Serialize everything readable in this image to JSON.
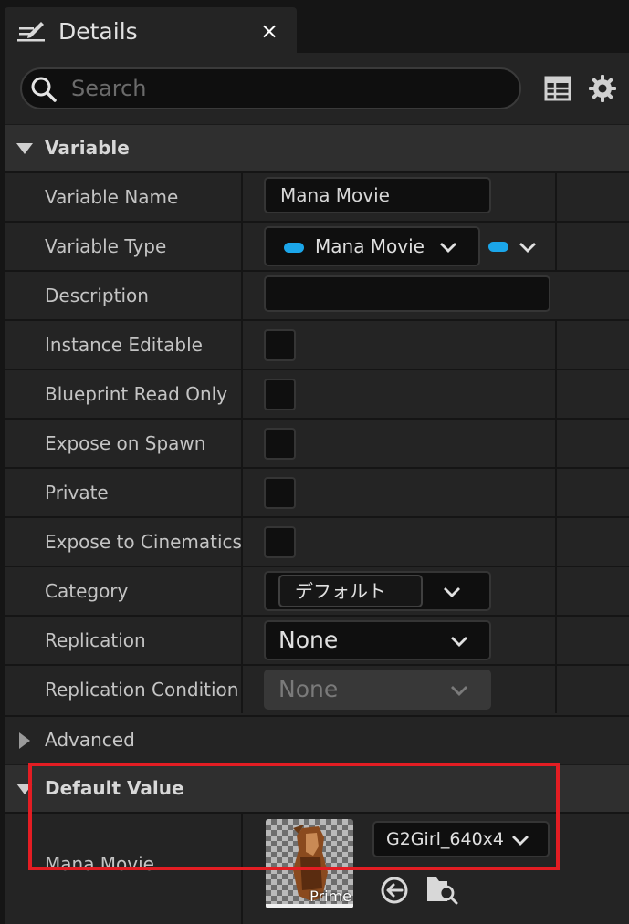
{
  "tab": {
    "title": "Details",
    "close_glyph": "×"
  },
  "search": {
    "placeholder": "Search"
  },
  "toolbar_icons": [
    "table-icon",
    "gear-icon"
  ],
  "sections": {
    "variable": "Variable",
    "advanced": "Advanced",
    "default_value": "Default Value"
  },
  "rows": {
    "variable_name": {
      "label": "Variable Name",
      "value": "Mana Movie"
    },
    "variable_type": {
      "label": "Variable Type",
      "value": "Mana Movie"
    },
    "description": {
      "label": "Description",
      "value": ""
    },
    "instance_editable": {
      "label": "Instance Editable",
      "checked": false
    },
    "blueprint_read_only": {
      "label": "Blueprint Read Only",
      "checked": false
    },
    "expose_on_spawn": {
      "label": "Expose on Spawn",
      "checked": false
    },
    "private": {
      "label": "Private",
      "checked": false
    },
    "expose_to_cinematics": {
      "label": "Expose to Cinematics",
      "checked": false
    },
    "category": {
      "label": "Category",
      "value": "デフォルト"
    },
    "replication": {
      "label": "Replication",
      "value": "None"
    },
    "replication_condition": {
      "label": "Replication Condition",
      "value": "None"
    }
  },
  "default_value": {
    "label": "Mana Movie",
    "asset": "G2Girl_640x4",
    "thumbnail_label": "Prime"
  },
  "colors": {
    "accent_pill": "#1ba6ea",
    "highlight": "#e31d23"
  }
}
